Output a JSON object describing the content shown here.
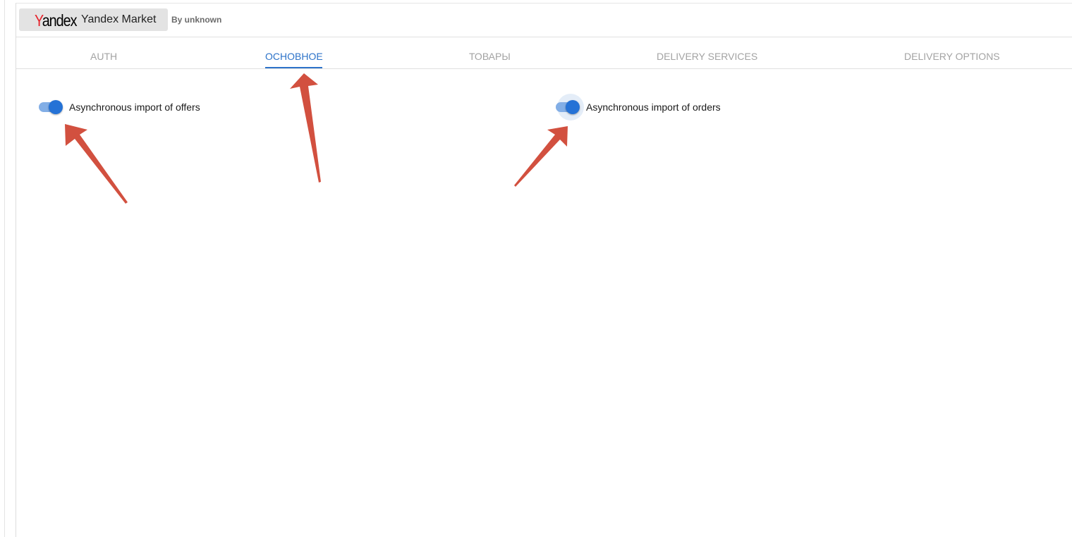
{
  "header": {
    "logo_prefix": "Y",
    "logo_rest": "andex",
    "app_name": "Yandex Market",
    "author": "By unknown"
  },
  "tabs": [
    {
      "label": "AUTH",
      "active": false
    },
    {
      "label": "ОСНОВНОЕ",
      "active": true
    },
    {
      "label": "ТОВАРЫ",
      "active": false
    },
    {
      "label": "DELIVERY SERVICES",
      "active": false
    },
    {
      "label": "DELIVERY OPTIONS",
      "active": false
    }
  ],
  "settings": {
    "async_offers": {
      "label": "Asynchronous import of offers",
      "enabled": true
    },
    "async_orders": {
      "label": "Asynchronous import of orders",
      "enabled": true
    }
  },
  "colors": {
    "accent": "#2d73c9",
    "annotation_arrow": "#d2503f",
    "logo_red": "#e6232b"
  },
  "annotations": {
    "icon": "arrow-annotation",
    "count": 3
  }
}
